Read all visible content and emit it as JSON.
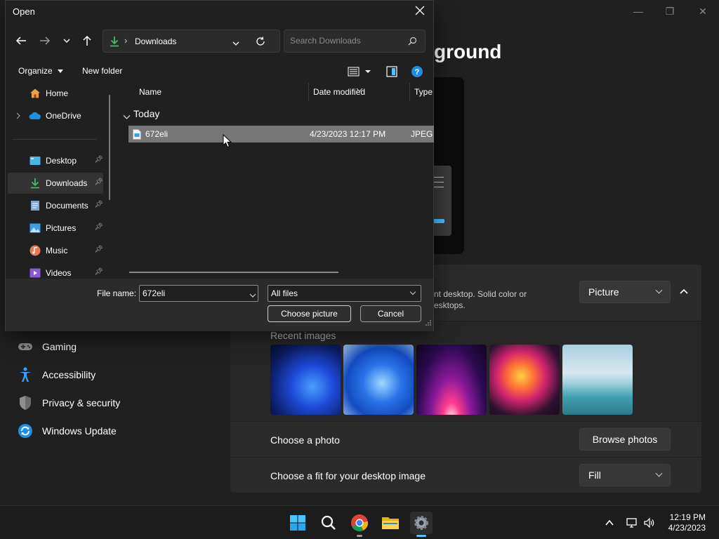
{
  "settings": {
    "title_fragment": "ground",
    "window_controls": [
      "—",
      "❐",
      "✕"
    ],
    "nav_items": [
      {
        "label": "Gaming",
        "icon": "gamepad-icon"
      },
      {
        "label": "Accessibility",
        "icon": "accessibility-icon"
      },
      {
        "label": "Privacy & security",
        "icon": "shield-icon"
      },
      {
        "label": "Windows Update",
        "icon": "update-icon"
      }
    ],
    "background_card": {
      "description_line1": "nt desktop. Solid color or",
      "description_line2": "esktops.",
      "dropdown_value": "Picture"
    },
    "recent_images_label": "Recent images",
    "choose_photo_label": "Choose a photo",
    "browse_photos_label": "Browse photos",
    "fit_label": "Choose a fit for your desktop image",
    "fit_value": "Fill",
    "colors": {
      "accent": "#4cc2ff",
      "bg": "#202020",
      "card": "#2b2b2b"
    }
  },
  "dialog": {
    "title": "Open",
    "address": {
      "folder": "Downloads"
    },
    "search": {
      "placeholder": "Search Downloads"
    },
    "commands": {
      "organize": "Organize",
      "new_folder": "New folder"
    },
    "nav_pane": [
      {
        "label": "Home",
        "icon": "home-icon",
        "pinned": false
      },
      {
        "label": "OneDrive",
        "icon": "cloud-icon",
        "pinned": false
      },
      {
        "label": "Desktop",
        "icon": "desktop-icon",
        "pinned": true
      },
      {
        "label": "Downloads",
        "icon": "download-icon",
        "pinned": true,
        "selected": true
      },
      {
        "label": "Documents",
        "icon": "document-icon",
        "pinned": true
      },
      {
        "label": "Pictures",
        "icon": "pictures-icon",
        "pinned": true
      },
      {
        "label": "Music",
        "icon": "music-icon",
        "pinned": true
      },
      {
        "label": "Videos",
        "icon": "videos-icon",
        "pinned": true
      }
    ],
    "columns": {
      "name": "Name",
      "date_modified": "Date modified",
      "type": "Type"
    },
    "group": "Today",
    "file": {
      "name": "672eli",
      "date": "4/23/2023 12:17 PM",
      "type": "JPEG"
    },
    "footer": {
      "file_name_label": "File name:",
      "file_name_value": "672eli",
      "file_type": "All files",
      "choose_button": "Choose picture",
      "cancel_button": "Cancel"
    }
  },
  "taskbar": {
    "apps": [
      "start-icon",
      "search-icon",
      "chrome-icon",
      "file-explorer-icon",
      "settings-icon"
    ],
    "time": "12:19 PM",
    "date": "4/23/2023"
  }
}
